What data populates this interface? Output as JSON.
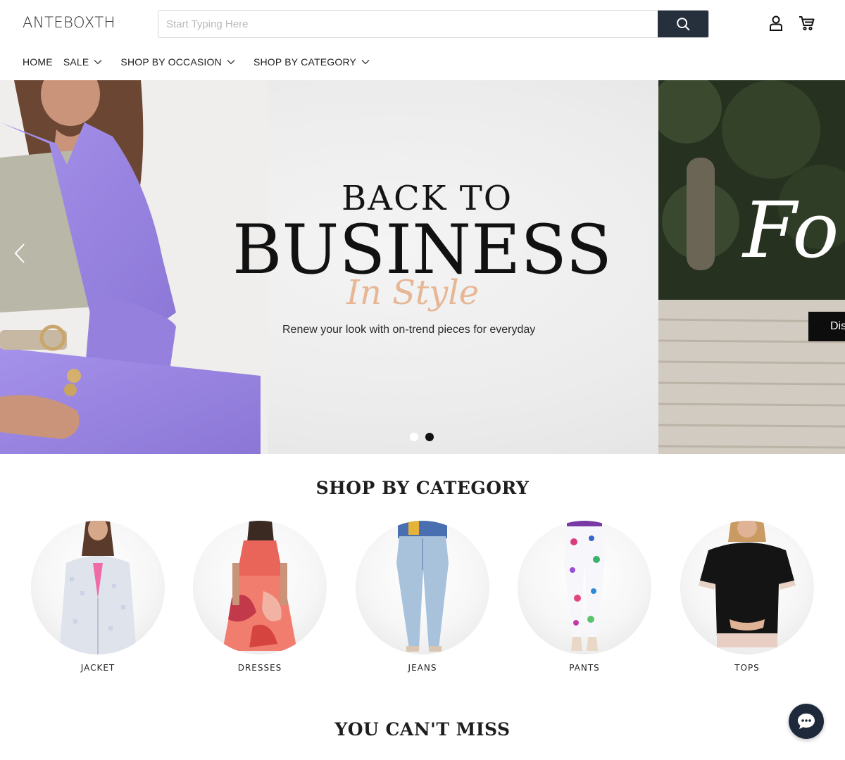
{
  "header": {
    "logo": "ANTEBOXTH",
    "search_placeholder": "Start Typing Here",
    "search_value": ""
  },
  "nav": {
    "items": [
      {
        "label": "HOME"
      },
      {
        "label": "SALE"
      },
      {
        "label": "SHOP BY OCCASION"
      },
      {
        "label": "SHOP BY CATEGORY"
      }
    ]
  },
  "banner": {
    "slide_main": {
      "line1": "BACK TO",
      "line2": "BUSINESS",
      "script": "In Style",
      "subtitle": "Renew your look with on-trend pieces for everyday"
    },
    "slide_next": {
      "script_partial": "Fo",
      "button_partial": "Dis"
    },
    "dot_count": 2,
    "active_dot": 2
  },
  "categories": {
    "title": "SHOP BY CATEGORY",
    "items": [
      {
        "label": "JACKET"
      },
      {
        "label": "DRESSES"
      },
      {
        "label": "JEANS"
      },
      {
        "label": "PANTS"
      },
      {
        "label": "TOPS"
      }
    ]
  },
  "miss": {
    "title": "YOU CAN'T MISS"
  },
  "colors": {
    "search_button": "#26303d",
    "chat_button": "#1e2a3c",
    "suit_lavender": "#9c88e0",
    "script_peach": "#e6b08c"
  },
  "icons": {
    "search": "search-icon",
    "account": "user-icon",
    "cart": "cart-icon",
    "chat": "chat-icon",
    "prev": "chevron-left-icon"
  }
}
